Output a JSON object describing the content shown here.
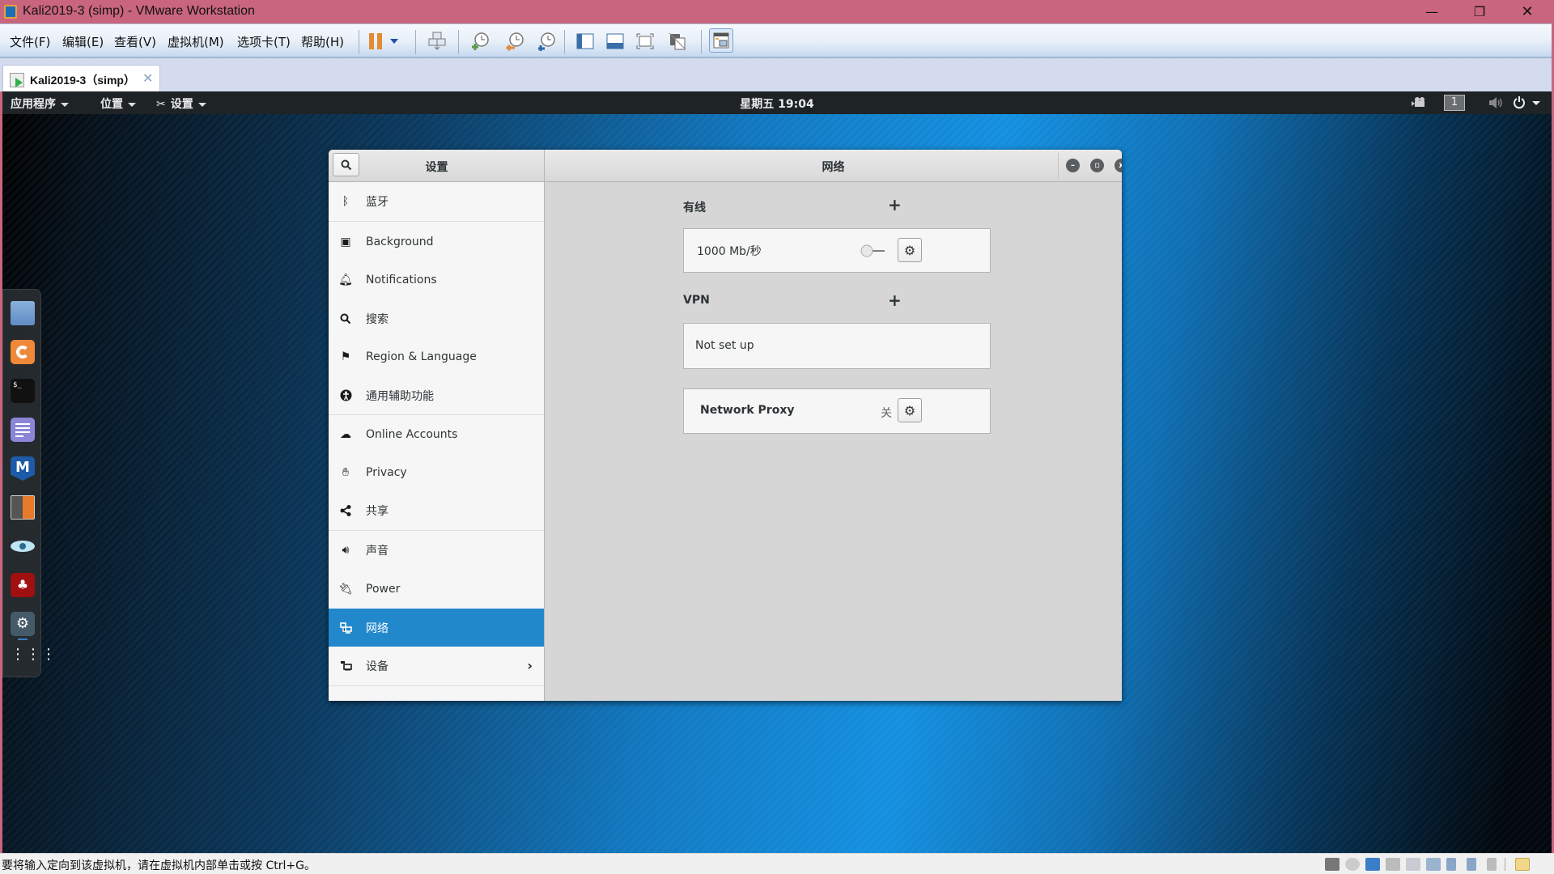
{
  "window": {
    "title": "Kali2019-3  (simp)   - VMware Workstation",
    "controls": {
      "minimize": "—",
      "restore": "❐",
      "close": "✕"
    }
  },
  "menubar": {
    "items": [
      "文件(F)",
      "编辑(E)",
      "查看(V)",
      "虚拟机(M)",
      "选项卡(T)",
      "帮助(H)"
    ]
  },
  "toolbar": {
    "icons": [
      "pause-icon",
      "dropdown-icon",
      "send-ctrl-alt-del-icon",
      "take-snapshot-icon",
      "revert-snapshot-icon",
      "snapshot-manager-icon",
      "console-view-icon",
      "fullscreen-bar-icon",
      "fit-guest-icon",
      "unity-icon",
      "thumbnail-view-icon"
    ],
    "accent": "#e38a35"
  },
  "tab": {
    "label": "Kali2019-3（simp）",
    "close": "✕"
  },
  "guest_topbar": {
    "applications": "应用程序",
    "places": "位置",
    "settings": "设置",
    "clock": "星期五 19:04",
    "workspace": "1"
  },
  "dock": {
    "apps": [
      "files-icon",
      "firefox-icon",
      "terminal-icon",
      "text-editor-icon",
      "metasploit-icon",
      "burpsuite-icon",
      "eye-icon",
      "cherrytree-icon",
      "settings-app-icon",
      "show-apps-icon"
    ]
  },
  "settings": {
    "sidebar_title": "设置",
    "panel_title": "网络",
    "selected_color": "#2288cc",
    "sidebar": [
      {
        "label": "蓝牙",
        "icon": "bluetooth-icon"
      },
      {
        "label": "Background",
        "icon": "background-icon"
      },
      {
        "label": "Notifications",
        "icon": "bell-icon"
      },
      {
        "label": "搜索",
        "icon": "search-icon"
      },
      {
        "label": "Region & Language",
        "icon": "flag-icon"
      },
      {
        "label": "通用辅助功能",
        "icon": "accessibility-icon"
      },
      {
        "label": "Online Accounts",
        "icon": "cloud-icon"
      },
      {
        "label": "Privacy",
        "icon": "hand-icon"
      },
      {
        "label": "共享",
        "icon": "share-icon"
      },
      {
        "label": "声音",
        "icon": "speaker-icon"
      },
      {
        "label": "Power",
        "icon": "power-plug-icon"
      },
      {
        "label": "网络",
        "icon": "network-icon",
        "selected": true
      },
      {
        "label": "设备",
        "icon": "devices-icon",
        "has_submenu": true
      }
    ],
    "network": {
      "wired": {
        "label": "有线",
        "add": "+",
        "speed": "1000 Mb/秒",
        "toggle_on": false
      },
      "vpn": {
        "label": "VPN",
        "add": "+",
        "status": "Not set up"
      },
      "proxy": {
        "label": "Network Proxy",
        "status": "关"
      }
    }
  },
  "statusbar": {
    "hint": "要将输入定向到该虚拟机，请在虚拟机内部单击或按 Ctrl+G。",
    "device_icons": [
      "hdd-icon",
      "cdrom-icon",
      "network-adapter-icon",
      "printer-icon",
      "sound-icon",
      "display-icon",
      "usb-icon",
      "usb-icon",
      "bluetooth-device-icon",
      "message-icon"
    ]
  }
}
